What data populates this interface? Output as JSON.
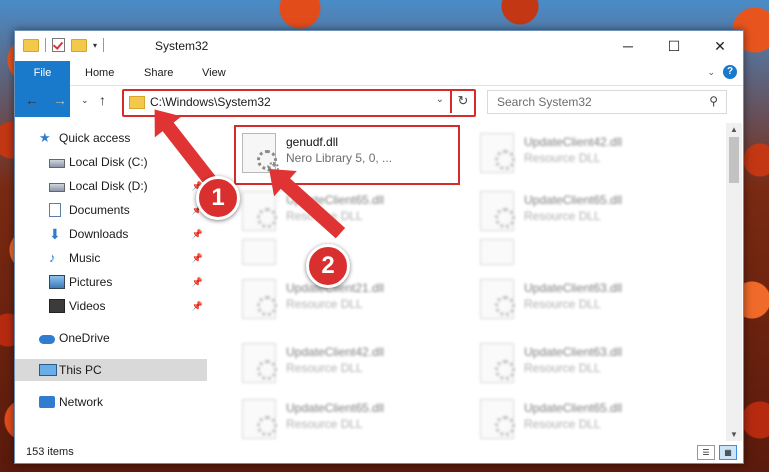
{
  "window": {
    "title": "System32"
  },
  "ribbon": {
    "tabs": [
      "File",
      "Home",
      "Share",
      "View"
    ],
    "help": "?"
  },
  "address": {
    "path": "C:\\Windows\\System32",
    "refresh_glyph": "↻"
  },
  "search": {
    "placeholder": "Search System32"
  },
  "sidebar": {
    "items": [
      {
        "label": "Quick access"
      },
      {
        "label": "Local Disk (C:)"
      },
      {
        "label": "Local Disk (D:)"
      },
      {
        "label": "Documents"
      },
      {
        "label": "Downloads"
      },
      {
        "label": "Music"
      },
      {
        "label": "Pictures"
      },
      {
        "label": "Videos"
      },
      {
        "label": "OneDrive"
      },
      {
        "label": "This PC"
      },
      {
        "label": "Network"
      }
    ]
  },
  "files": [
    {
      "name": "genudf.dll",
      "desc": "Nero Library 5, 0, ..."
    },
    {
      "name": "UpdateClient42.dll",
      "desc": "Resource DLL"
    },
    {
      "name": "UpdateClient65.dll",
      "desc": "Resource DLL"
    },
    {
      "name": "UpdateClient65.dll",
      "desc": "Resource DLL"
    },
    {
      "name": "UpdateClient21.dll",
      "desc": "Resource DLL"
    },
    {
      "name": "UpdateClient63.dll",
      "desc": "Resource DLL"
    },
    {
      "name": "UpdateClient42.dll",
      "desc": "Resource DLL"
    },
    {
      "name": "UpdateClient63.dll",
      "desc": "Resource DLL"
    },
    {
      "name": "UpdateClient65.dll",
      "desc": "Resource DLL"
    },
    {
      "name": "UpdateClient65.dll",
      "desc": "Resource DLL"
    }
  ],
  "status": {
    "count": "153 items"
  },
  "annotations": {
    "step1": "1",
    "step2": "2"
  },
  "colors": {
    "accent": "#1979ca",
    "highlight": "#d62b2b"
  }
}
